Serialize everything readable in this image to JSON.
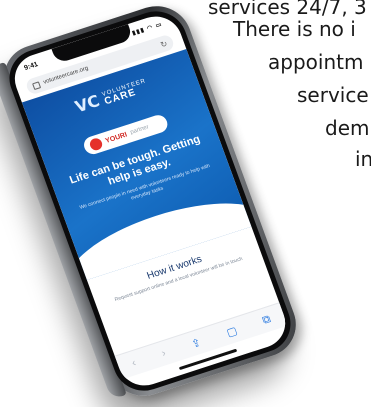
{
  "background_text": {
    "lines": [
      "services 24/7, 3",
      "There is no i",
      "appointm",
      "service",
      "dem",
      "in"
    ]
  },
  "phone": {
    "status": {
      "time": "9:41",
      "signal": "▮▮▮ ◠ ▭"
    },
    "browser": {
      "url": "volunteercare.org",
      "reload_icon": "reload-icon"
    },
    "hero": {
      "logo_small": "VOLUNTEER",
      "logo_big": "CARE",
      "partner_name": "YOURI",
      "partner_sub": "partner",
      "headline": "Life can be tough. Getting help is easy.",
      "subtext": "We connect people in need with volunteers ready to help with everyday tasks"
    },
    "how_it_works": {
      "title": "How it works",
      "body": "Request support online and a local volunteer will be in touch"
    },
    "toolbar": [
      "‹",
      "›",
      "⇪",
      "▢",
      "⧉"
    ],
    "colors": {
      "hero_blue": "#1a73c9",
      "accent_red": "#e5312b"
    }
  }
}
